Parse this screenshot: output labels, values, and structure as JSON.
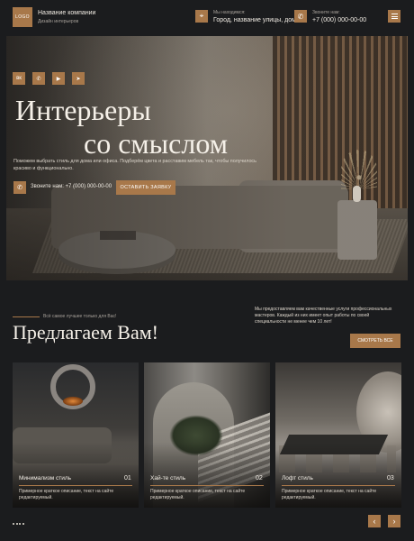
{
  "header": {
    "logo": "LOGO",
    "company_name": "Название компании",
    "company_sub": "Дизайн интерьеров",
    "location_label": "Мы находимся:",
    "location_value": "Город, название улицы, дом",
    "phone_label": "Звоните нам:",
    "phone_value": "+7 (000) 000-00-00",
    "location_icon": "location-pin-icon",
    "phone_icon": "phone-icon",
    "menu_icon": "hamburger-menu-icon"
  },
  "hero": {
    "social_icons": [
      "vk-icon",
      "whatsapp-icon",
      "youtube-icon",
      "telegram-icon"
    ],
    "social_glyphs": [
      "вк",
      "✆",
      "▶",
      "➤"
    ],
    "title_line1": "Интерьеры",
    "title_line2": "со смыслом",
    "description": "Поможем выбрать стиль для дома или офиса. Подберём цвета и расставим мебель так, чтобы получилось красиво и функционально.",
    "phone_label": "Звоните нам:",
    "phone_value": "+7 (000) 000-00-00",
    "cta_label": "ОСТАВИТЬ ЗАЯВКУ"
  },
  "offer": {
    "tagline": "Всё самое лучшее только для Вас!",
    "title": "Предлагаем Вам!",
    "description": "Мы предоставляем вам качественные услуги профессиональных мастеров. Каждый из них имеет опыт работы по своей специальности не менее чем 10 лет!",
    "see_all_label": "СМОТРЕТЬ ВСЕ"
  },
  "cards": [
    {
      "title": "Минимализм стиль",
      "num": "01",
      "desc": "Примерное краткое описание, текст на сайте редактируемый."
    },
    {
      "title": "Хай-те стиль",
      "num": "02",
      "desc": "Примерное краткое описание, текст на сайте редактируемый."
    },
    {
      "title": "Лофт стиль",
      "num": "03",
      "desc": "Примерное краткое описание, текст на сайте редактируемый."
    }
  ],
  "nav": {
    "prev_glyph": "‹",
    "next_glyph": "›",
    "accent": "#a8784a"
  }
}
